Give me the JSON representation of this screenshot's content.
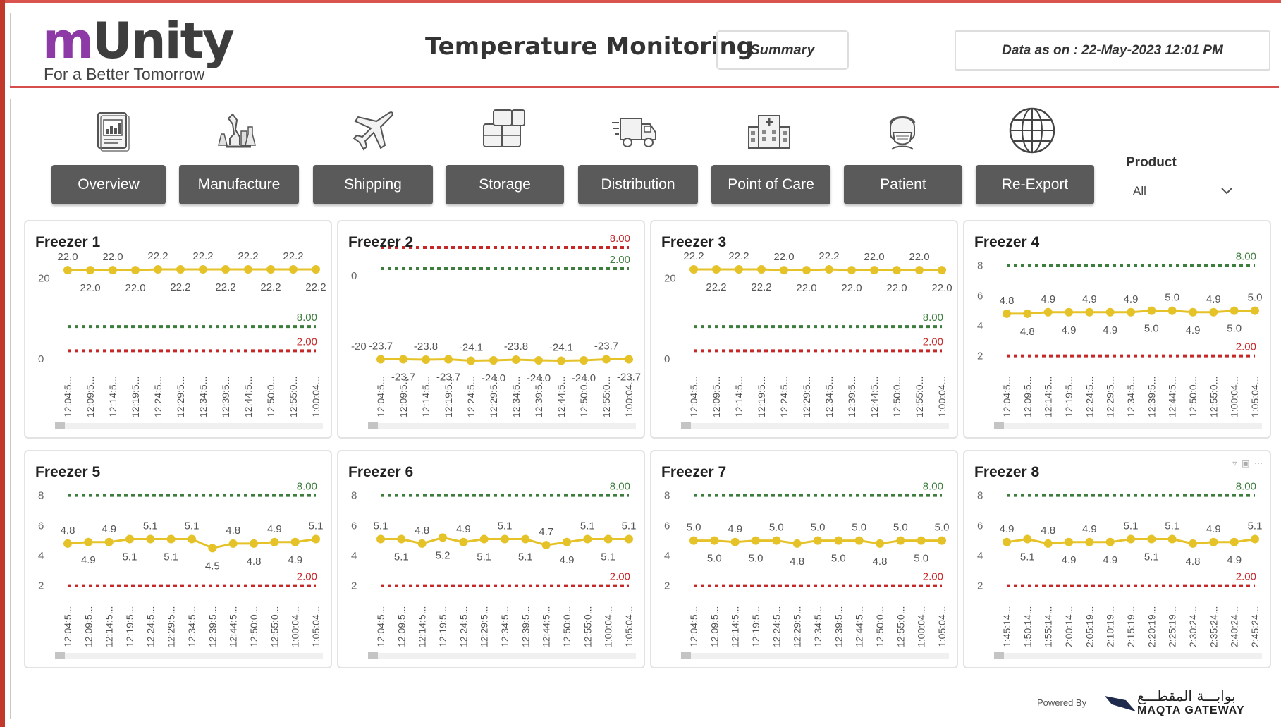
{
  "logo": {
    "brand_m": "m",
    "brand_rest": "Unity",
    "tagline": "For a Better Tomorrow"
  },
  "header": {
    "title": "Temperature Monitoring",
    "summary_button": "Summary",
    "data_as_on": "Data as on : 22-May-2023 12:01 PM"
  },
  "nav": [
    {
      "label": "Overview",
      "icon": "report-chart-icon"
    },
    {
      "label": "Manufacture",
      "icon": "laboratory-icon"
    },
    {
      "label": "Shipping",
      "icon": "airplane-icon"
    },
    {
      "label": "Storage",
      "icon": "boxes-icon"
    },
    {
      "label": "Distribution",
      "icon": "delivery-truck-icon"
    },
    {
      "label": "Point of Care",
      "icon": "hospital-icon"
    },
    {
      "label": "Patient",
      "icon": "patient-mask-icon"
    },
    {
      "label": "Re-Export",
      "icon": "globe-icon"
    }
  ],
  "product_filter": {
    "label": "Product",
    "selected": "All"
  },
  "colors": {
    "series": "#e6c229",
    "upper_limit": "#3d7d3d",
    "lower_limit": "#c62828",
    "nav_button": "#5a5a5a",
    "accent": "#d54d4d",
    "brand_purple": "#8e3aa6"
  },
  "footer": {
    "powered_by": "Powered By",
    "partner_arabic": "بوابـــة المقطـــع",
    "partner_latin": "MAQTA GATEWAY"
  },
  "chart_data": [
    {
      "type": "line",
      "title": "Freezer 1",
      "x": [
        "12:04:5...",
        "12:09:5...",
        "12:14:5...",
        "12:19:5...",
        "12:24:5...",
        "12:29:5...",
        "12:34:5...",
        "12:39:5...",
        "12:44:5...",
        "12:50:0...",
        "12:55:0...",
        "1:00:04..."
      ],
      "values": [
        22.0,
        22.0,
        22.0,
        22.0,
        22.2,
        22.2,
        22.2,
        22.2,
        22.2,
        22.2,
        22.2,
        22.2
      ],
      "upper_limit": 8.0,
      "lower_limit": 2.0,
      "upper_label": "8.00",
      "lower_label": "2.00",
      "y_ticks": [
        "20",
        "0"
      ],
      "ylim": [
        -3,
        25
      ]
    },
    {
      "type": "line",
      "title": "Freezer 2",
      "x": [
        "12:04:5...",
        "12:09:5...",
        "12:14:5...",
        "12:19:5...",
        "12:24:5...",
        "12:29:5...",
        "12:34:5...",
        "12:39:5...",
        "12:44:5...",
        "12:50:0...",
        "12:55:0...",
        "1:00:04..."
      ],
      "values": [
        -23.7,
        -23.7,
        -23.8,
        -23.7,
        -24.1,
        -24.0,
        -23.8,
        -24.0,
        -24.1,
        -24.0,
        -23.7,
        -23.7
      ],
      "upper_limit": 2.0,
      "lower_limit": 8.0,
      "upper_label": "2.00",
      "lower_label": "8.00",
      "y_ticks": [
        "0",
        "-20"
      ],
      "ylim": [
        -27,
        5
      ]
    },
    {
      "type": "line",
      "title": "Freezer 3",
      "x": [
        "12:04:5...",
        "12:09:5...",
        "12:14:5...",
        "12:19:5...",
        "12:24:5...",
        "12:29:5...",
        "12:34:5...",
        "12:39:5...",
        "12:44:5...",
        "12:50:0...",
        "12:55:0...",
        "1:00:04..."
      ],
      "values": [
        22.2,
        22.2,
        22.2,
        22.2,
        22.0,
        22.0,
        22.2,
        22.0,
        22.0,
        22.0,
        22.0,
        22.0
      ],
      "upper_limit": 8.0,
      "lower_limit": 2.0,
      "upper_label": "8.00",
      "lower_label": "2.00",
      "y_ticks": [
        "20",
        "0"
      ],
      "ylim": [
        -3,
        25
      ]
    },
    {
      "type": "line",
      "title": "Freezer 4",
      "x": [
        "12:04:5...",
        "12:09:5...",
        "12:14:5...",
        "12:19:5...",
        "12:24:5...",
        "12:29:5...",
        "12:34:5...",
        "12:39:5...",
        "12:44:5...",
        "12:50:0...",
        "12:55:0...",
        "1:00:04...",
        "1:05:04..."
      ],
      "values": [
        4.8,
        4.8,
        4.9,
        4.9,
        4.9,
        4.9,
        4.9,
        5.0,
        5.0,
        4.9,
        4.9,
        5.0,
        5.0
      ],
      "upper_limit": 8.0,
      "lower_limit": 2.0,
      "upper_label": "8.00",
      "lower_label": "2.00",
      "y_ticks": [
        "8",
        "6",
        "4",
        "2"
      ],
      "ylim": [
        1,
        8.5
      ]
    },
    {
      "type": "line",
      "title": "Freezer 5",
      "x": [
        "12:04:5...",
        "12:09:5...",
        "12:14:5...",
        "12:19:5...",
        "12:24:5...",
        "12:29:5...",
        "12:34:5...",
        "12:39:5...",
        "12:44:5...",
        "12:50:0...",
        "12:55:0...",
        "1:00:04...",
        "1:05:04..."
      ],
      "values": [
        4.8,
        4.9,
        4.9,
        5.1,
        5.1,
        5.1,
        5.1,
        4.5,
        4.8,
        4.8,
        4.9,
        4.9,
        5.1
      ],
      "upper_limit": 8.0,
      "lower_limit": 2.0,
      "upper_label": "8.00",
      "lower_label": "2.00",
      "y_ticks": [
        "8",
        "6",
        "4",
        "2"
      ],
      "ylim": [
        1,
        8.5
      ]
    },
    {
      "type": "line",
      "title": "Freezer 6",
      "x": [
        "12:04:5...",
        "12:09:5...",
        "12:14:5...",
        "12:19:5...",
        "12:24:5...",
        "12:29:5...",
        "12:34:5...",
        "12:39:5...",
        "12:44:5...",
        "12:50:0...",
        "12:55:0...",
        "1:00:04...",
        "1:05:04..."
      ],
      "values": [
        5.1,
        5.1,
        4.8,
        5.2,
        4.9,
        5.1,
        5.1,
        5.1,
        4.7,
        4.9,
        5.1,
        5.1,
        5.1
      ],
      "upper_limit": 8.0,
      "lower_limit": 2.0,
      "upper_label": "8.00",
      "lower_label": "2.00",
      "y_ticks": [
        "8",
        "6",
        "4",
        "2"
      ],
      "ylim": [
        1,
        8.5
      ]
    },
    {
      "type": "line",
      "title": "Freezer 7",
      "x": [
        "12:04:5...",
        "12:09:5...",
        "12:14:5...",
        "12:19:5...",
        "12:24:5...",
        "12:29:5...",
        "12:34:5...",
        "12:39:5...",
        "12:44:5...",
        "12:50:0...",
        "12:55:0...",
        "1:00:04...",
        "1:05:04..."
      ],
      "values": [
        5.0,
        5.0,
        4.9,
        5.0,
        5.0,
        4.8,
        5.0,
        5.0,
        5.0,
        4.8,
        5.0,
        5.0,
        5.0
      ],
      "upper_limit": 8.0,
      "lower_limit": 2.0,
      "upper_label": "8.00",
      "lower_label": "2.00",
      "y_ticks": [
        "8",
        "6",
        "4",
        "2"
      ],
      "ylim": [
        1,
        8.5
      ]
    },
    {
      "type": "line",
      "title": "Freezer 8",
      "x": [
        "1:45:14...",
        "1:50:14...",
        "1:55:14...",
        "2:00:14...",
        "2:05:19...",
        "2:10:19...",
        "2:15:19...",
        "2:20:19...",
        "2:25:19...",
        "2:30:24...",
        "2:35:24...",
        "2:40:24...",
        "2:45:24..."
      ],
      "values": [
        4.9,
        5.1,
        4.8,
        4.9,
        4.9,
        4.9,
        5.1,
        5.1,
        5.1,
        4.8,
        4.9,
        4.9,
        5.1
      ],
      "upper_limit": 8.0,
      "lower_limit": 2.0,
      "upper_label": "8.00",
      "lower_label": "2.00",
      "y_ticks": [
        "8",
        "6",
        "4",
        "2"
      ],
      "ylim": [
        1,
        8.5
      ]
    }
  ]
}
